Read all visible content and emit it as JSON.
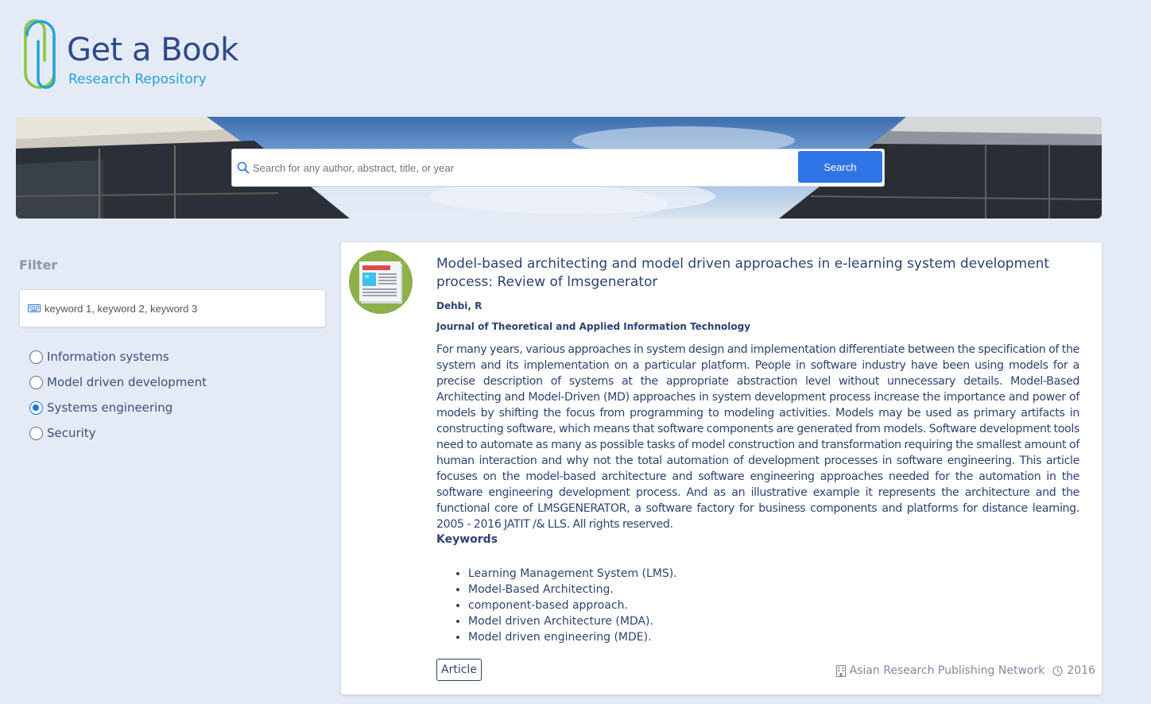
{
  "logo": {
    "title": "Get a Book",
    "subtitle": "Research Repository"
  },
  "search": {
    "placeholder": "Search for any author, abstract, title, or year",
    "button_label": "Search"
  },
  "filter": {
    "title": "Filter",
    "keyword_placeholder": "keyword 1, keyword 2, keyword 3",
    "topics": [
      {
        "label": "Information systems",
        "checked": false
      },
      {
        "label": "Model driven development",
        "checked": false
      },
      {
        "label": "Systems engineering",
        "checked": true
      },
      {
        "label": "Security",
        "checked": false
      }
    ]
  },
  "result": {
    "title": "Model-based architecting and model driven approaches in e-learning system development process: Review of lmsgenerator",
    "authors": "Dehbi, R",
    "journal": "Journal of Theoretical and Applied Information Technology",
    "abstract": "For many years, various approaches in system design and implementation differentiate between the specification of the system and its implementation on a particular platform. People in software industry have been using models for a precise description of systems at the appropriate abstraction level without unnecessary details. Model-Based Architecting and Model-Driven (MD) approaches in system development process increase the importance and power of models by shifting the focus from programming to modeling activities. Models may be used as primary artifacts in constructing software, which means that software components are generated from models. Software development tools need to automate as many as possible tasks of model construction and transformation requiring the smallest amount of human interaction and why not the total automation of development processes in software engineering. This article focuses on the model-based architecture and software engineering approaches needed for the automation in the software engineering development process. And as an illustrative example it represents the architecture and the functional core of LMSGENERATOR, a software factory for business components and platforms for distance learning. 2005 - 2016 JATIT /& LLS. All rights reserved.",
    "keywords_heading": "Keywords",
    "keywords": [
      "Learning Management System (LMS).",
      "Model-Based Architecting.",
      "component-based approach.",
      "Model driven Architecture (MDA).",
      "Model driven engineering (MDE)."
    ],
    "type": "Article",
    "publisher": "Asian Research Publishing Network",
    "year": "2016",
    "publisher_icon": "building-icon",
    "year_icon": "clock-icon",
    "thumbnail_icon": "newspaper-icon"
  },
  "colors": {
    "background": "#e5ebf6",
    "accent": "#2f74e6",
    "text": "#2a4373",
    "thumbnail_bg": "#8db04a"
  }
}
